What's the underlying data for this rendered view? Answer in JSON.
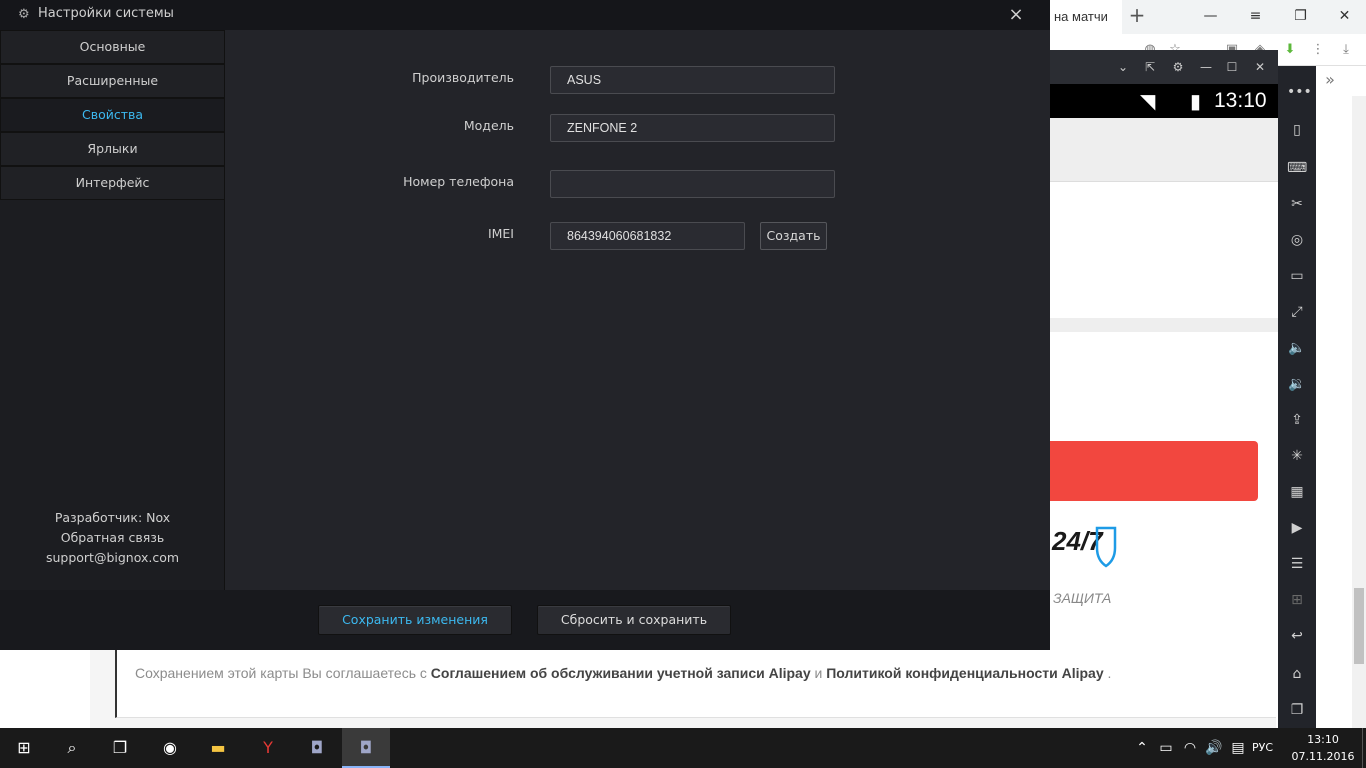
{
  "dialog": {
    "title": "Настройки системы",
    "close_symbol": "×",
    "nav": [
      {
        "label": "Основные",
        "active": false
      },
      {
        "label": "Расширенные",
        "active": false
      },
      {
        "label": "Свойства",
        "active": true
      },
      {
        "label": "Ярлыки",
        "active": false
      },
      {
        "label": "Интерфейс",
        "active": false
      }
    ],
    "developer": "Разработчик: Nox",
    "feedback": "Обратная связь",
    "support_email": "support@bignox.com",
    "fields": {
      "manufacturer_label": "Производитель",
      "manufacturer_value": "ASUS",
      "model_label": "Модель",
      "model_value": "ZENFONE 2",
      "phone_label": "Номер телефона",
      "phone_value": "",
      "imei_label": "IMEI",
      "imei_value": "864394060681832",
      "create_button": "Создать"
    },
    "footer": {
      "save_button": "Сохранить изменения",
      "reset_button": "Сбросить и сохранить"
    },
    "accent_color": "#3cb9f0"
  },
  "browser": {
    "tab_label": "на матчи",
    "new_tab_symbol": "+",
    "bookmarks_overflow": "»",
    "agreement": {
      "prefix": "Сохранением этой карты Вы соглашаетесь с",
      "link1": "Соглашением об обслуживании учетной записи Alipay",
      "middle": "и",
      "link2": "Политикой конфиденциальности Alipay",
      "suffix": "."
    }
  },
  "emulator": {
    "clock": "13:10",
    "protection_badge": "24/7",
    "protection_label": "ЗАЩИТА",
    "action_color": "#f2473f"
  },
  "taskbar": {
    "language": "РУС",
    "time": "13:10",
    "date": "07.11.2016"
  }
}
